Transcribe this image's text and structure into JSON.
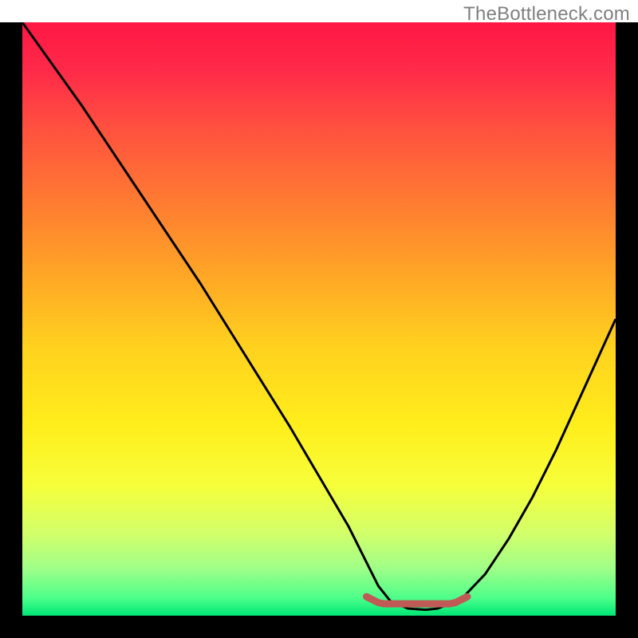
{
  "watermark": "TheBottleneck.com",
  "chart_data": {
    "type": "line",
    "title": "",
    "xlabel": "",
    "ylabel": "",
    "xlim": [
      0,
      100
    ],
    "ylim": [
      0,
      100
    ],
    "series": [
      {
        "name": "curve",
        "x": [
          0,
          5,
          10,
          15,
          20,
          25,
          30,
          35,
          40,
          45,
          50,
          55,
          58,
          60,
          62,
          65,
          68,
          70,
          74,
          78,
          82,
          86,
          90,
          95,
          100
        ],
        "y": [
          100,
          93,
          86,
          78.5,
          71,
          63.5,
          56,
          48,
          40,
          32,
          23.5,
          15,
          9,
          5,
          2.5,
          1.2,
          1.0,
          1.2,
          2.8,
          7,
          13,
          20,
          28,
          39,
          50
        ]
      },
      {
        "name": "bottom-marker",
        "x": [
          58,
          60,
          61,
          63,
          65,
          70,
          72,
          73,
          75
        ],
        "y": [
          3.2,
          2.2,
          2.0,
          2.0,
          2.0,
          2.0,
          2.0,
          2.2,
          3.2
        ]
      }
    ],
    "gradient_stops": [
      {
        "offset": 0.0,
        "color": "#ff1744"
      },
      {
        "offset": 0.08,
        "color": "#ff2a49"
      },
      {
        "offset": 0.18,
        "color": "#ff513f"
      },
      {
        "offset": 0.3,
        "color": "#ff7a32"
      },
      {
        "offset": 0.42,
        "color": "#ffa426"
      },
      {
        "offset": 0.55,
        "color": "#ffd21e"
      },
      {
        "offset": 0.68,
        "color": "#ffee1c"
      },
      {
        "offset": 0.78,
        "color": "#f6ff3a"
      },
      {
        "offset": 0.86,
        "color": "#d3ff6a"
      },
      {
        "offset": 0.92,
        "color": "#a0ff88"
      },
      {
        "offset": 0.97,
        "color": "#4dff8a"
      },
      {
        "offset": 1.0,
        "color": "#00e676"
      }
    ],
    "colors": {
      "curve_stroke": "#000000",
      "marker_stroke": "#c05a56",
      "frame": "#000000"
    }
  }
}
